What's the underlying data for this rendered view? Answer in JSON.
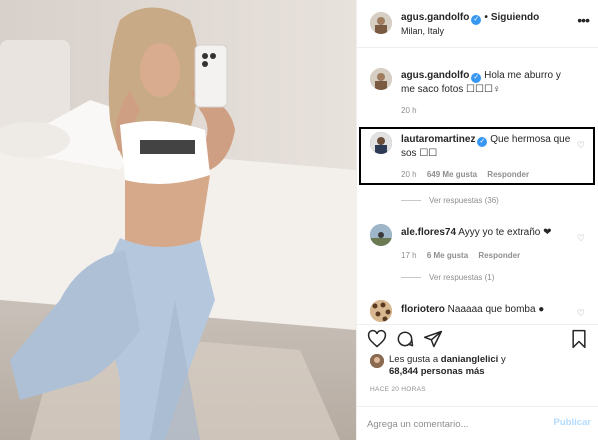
{
  "post": {
    "username": "agus.gandolfo",
    "follow_status": "Siguiendo",
    "dot": "•",
    "location": "Milan, Italy"
  },
  "caption": {
    "username": "agus.gandolfo",
    "text": "Hola me aburro y me saco fotos ☐☐☐♀",
    "time": "20 h"
  },
  "comments": [
    {
      "username": "lautaromartinez",
      "verified": true,
      "text": "Que hermosa que sos ☐☐",
      "time": "20 h",
      "likes": "649 Me gusta",
      "reply_label": "Responder",
      "view_replies": "Ver respuestas (36)",
      "highlighted": true
    },
    {
      "username": "ale.flores74",
      "verified": false,
      "text": "Ayyy yo te extraño ❤",
      "time": "17 h",
      "likes": "6 Me gusta",
      "reply_label": "Responder",
      "view_replies": "Ver respuestas (1)"
    },
    {
      "username": "floriotero",
      "verified": false,
      "text": "Naaaaa que bomba ●"
    }
  ],
  "likes": {
    "prefix": "Les gusta a",
    "user": "danianglelici",
    "suffix": "y",
    "count_text": "68,844 personas más"
  },
  "time_ago": "HACE 20 HORAS",
  "add_comment": {
    "placeholder": "Agrega un comentario...",
    "publish_label": "Publicar"
  },
  "colors": {
    "verified": "#3897f0",
    "publish_disabled": "#b3dbff",
    "highlight_border": "#000000"
  },
  "icons": [
    "more-icon",
    "heart-icon",
    "comment-icon",
    "share-icon",
    "bookmark-icon",
    "verified-icon"
  ]
}
